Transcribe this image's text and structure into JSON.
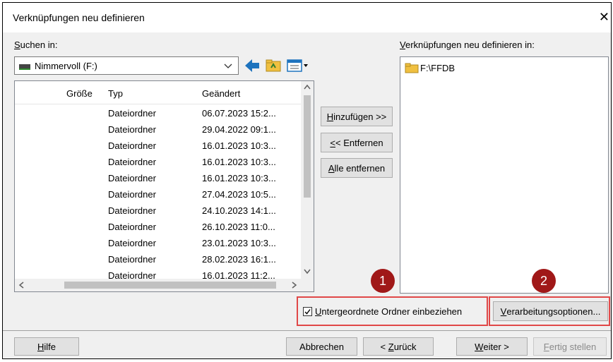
{
  "window": {
    "title": "Verknüpfungen neu definieren",
    "close_glyph": "✕"
  },
  "search": {
    "label_first": "S",
    "label_rest": "uchen in:",
    "drive": "Nimmervoll (F:)"
  },
  "list": {
    "columns": {
      "size": "Größe",
      "type": "Typ",
      "modified": "Geändert"
    },
    "rows": [
      {
        "type": "Dateiordner",
        "modified": "06.07.2023 15:2..."
      },
      {
        "type": "Dateiordner",
        "modified": "29.04.2022 09:1..."
      },
      {
        "type": "Dateiordner",
        "modified": "16.01.2023 10:3..."
      },
      {
        "type": "Dateiordner",
        "modified": "16.01.2023 10:3..."
      },
      {
        "type": "Dateiordner",
        "modified": "16.01.2023 10:3..."
      },
      {
        "type": "Dateiordner",
        "modified": "27.04.2023 10:5..."
      },
      {
        "type": "Dateiordner",
        "modified": "24.10.2023 14:1..."
      },
      {
        "type": "Dateiordner",
        "modified": "26.10.2023 11:0..."
      },
      {
        "type": "Dateiordner",
        "modified": "23.01.2023 10:3..."
      },
      {
        "type": "Dateiordner",
        "modified": "28.02.2023 16:1..."
      },
      {
        "type": "Dateiordner",
        "modified": "16.01.2023 11:2..."
      }
    ]
  },
  "middle": {
    "add_u": "H",
    "add_rest": "inzufügen >>",
    "remove_u": "<",
    "remove_rest": "< Entfernen",
    "remove_all_u": "A",
    "remove_all_rest": "lle entfernen"
  },
  "target": {
    "label_u": "V",
    "label_rest": "erknüpfungen neu definieren in:",
    "folder": "F:\\FFDB"
  },
  "options": {
    "checkbox_u": "U",
    "checkbox_rest": "ntergeordnete Ordner einbeziehen",
    "checkbox_checked": true,
    "processing_u": "V",
    "processing_rest": "erarbeitungsoptionen..."
  },
  "badges": {
    "one": "1",
    "two": "2"
  },
  "footer": {
    "help_u": "H",
    "help_rest": "ilfe",
    "cancel": "Abbrechen",
    "back_pre": "< ",
    "back_u": "Z",
    "back_rest": "urück",
    "next_u": "W",
    "next_rest": "eiter >",
    "finish_u": "F",
    "finish_rest": "ertig stellen"
  },
  "colors": {
    "highlight": "#e04848",
    "badge": "#a01818",
    "back_arrow": "#1e73be",
    "folder": "#f0c040"
  }
}
